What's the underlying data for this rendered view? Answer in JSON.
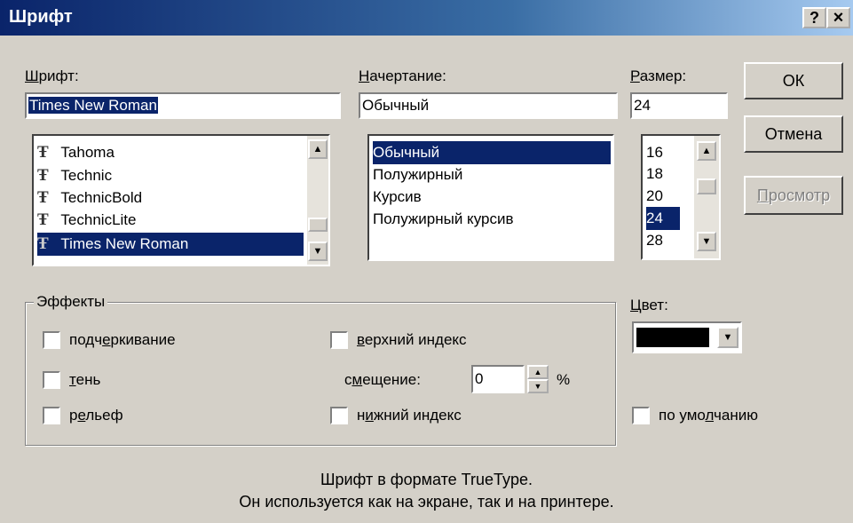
{
  "window": {
    "title": "Шрифт",
    "help_button": "?",
    "close_button": "×"
  },
  "font": {
    "label_prefix": "",
    "label_accel": "Ш",
    "label_rest": "рифт:",
    "value": "Times New Roman",
    "items": [
      "Tahoma",
      "Technic",
      "TechnicBold",
      "TechnicLite",
      "Times New Roman"
    ],
    "selected_index": 4,
    "truetype_icon": "Ŧ"
  },
  "style": {
    "label_accel": "Н",
    "label_rest": "ачертание:",
    "value": "Обычный",
    "items": [
      "Обычный",
      "Полужирный",
      "Курсив",
      "Полужирный курсив"
    ],
    "selected_index": 0
  },
  "size": {
    "label_accel": "Р",
    "label_rest": "азмер:",
    "value": "24",
    "items": [
      "16",
      "18",
      "20",
      "24",
      "28"
    ],
    "selected_index": 3
  },
  "buttons": {
    "ok": "ОК",
    "cancel": "Отмена",
    "preview_accel": "П",
    "preview_rest": "росмотр"
  },
  "effects": {
    "group_title": "Эффекты",
    "underline_a": "подч",
    "underline_accel": "е",
    "underline_b": "ркивание",
    "shadow_accel": "т",
    "shadow_rest": "ень",
    "emboss_a": "р",
    "emboss_accel": "е",
    "emboss_b": "льеф",
    "superscript_accel": "в",
    "superscript_rest": "ерхний индекс",
    "offset_a": "с",
    "offset_accel": "м",
    "offset_b": "ещение:",
    "offset_value": "0",
    "offset_unit": "%",
    "subscript_a": "н",
    "subscript_accel": "и",
    "subscript_b": "жний индекс"
  },
  "color": {
    "label_accel": "Ц",
    "label_rest": "вет:",
    "swatch": "#000000"
  },
  "default": {
    "a": "по умо",
    "accel": "л",
    "b": "чанию"
  },
  "info": {
    "line1": "Шрифт в формате TrueType.",
    "line2": "Он используется как на экране, так и на принтере."
  },
  "colors": {
    "titlebar": "#0a246a",
    "selection": "#0a246a",
    "face": "#d4d0c8"
  }
}
